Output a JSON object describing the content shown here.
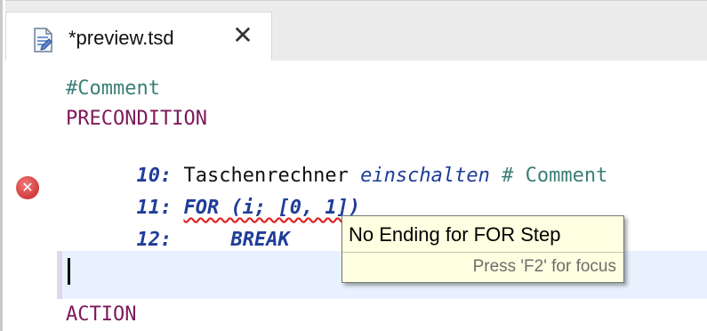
{
  "tab": {
    "title": "*preview.tsd",
    "icon": "tsd-file-icon",
    "close_glyph": "✕"
  },
  "editor": {
    "lines": {
      "comment": "#Comment",
      "precondition": "PRECONDITION",
      "line10": {
        "num": "10:",
        "text": " Taschenrechner ",
        "keyword": "einschalten",
        "comment": " # Comment"
      },
      "line11": {
        "num": "11:",
        "space": " ",
        "stmt": "FOR (i; [0, 1])"
      },
      "line12": {
        "num": "12:",
        "indent": "     ",
        "stmt": "BREAK"
      },
      "action": "ACTION"
    },
    "error_marker": "error-icon"
  },
  "tooltip": {
    "message": "No Ending for FOR Step",
    "hint": "Press 'F2' for focus"
  },
  "colors": {
    "comment": "#3b7f77",
    "section": "#7c1a5a",
    "keyword": "#1f3d99",
    "error": "#c42020",
    "current_line": "#e8f2fe",
    "tooltip_bg": "#ffffe1"
  }
}
